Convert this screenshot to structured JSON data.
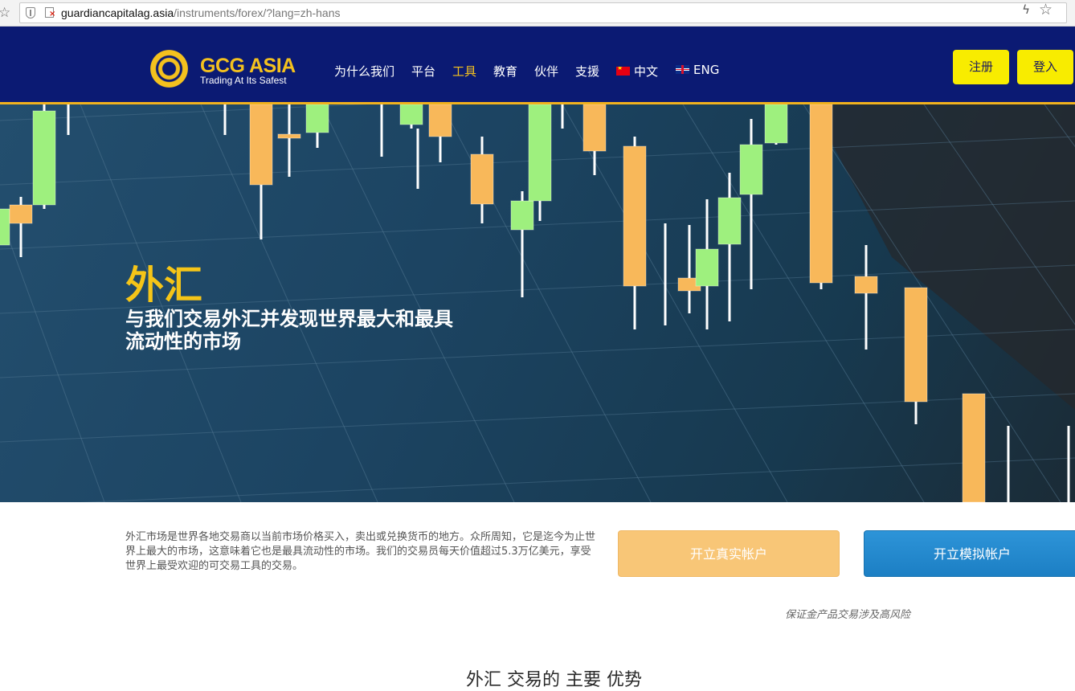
{
  "browser": {
    "url_host": "guardiancapitalag.asia",
    "url_path": "/instruments/forex/?lang=zh-hans"
  },
  "header": {
    "logo_name": "GCG ASIA",
    "logo_tagline": "Trading At Its Safest",
    "nav": [
      {
        "label": "为什么我们"
      },
      {
        "label": "平台"
      },
      {
        "label": "工具"
      },
      {
        "label": "教育"
      },
      {
        "label": "伙伴"
      },
      {
        "label": "支援"
      },
      {
        "label": "中文"
      },
      {
        "label": "ENG"
      }
    ],
    "active_nav": "工具",
    "register_label": "注册",
    "login_label": "登入"
  },
  "hero": {
    "title": "外汇",
    "subtitle": "与我们交易外汇并发现世界最大和最具流动性的市场"
  },
  "content": {
    "description": "外汇市场是世界各地交易商以当前市场价格买入，卖出或兑换货币的地方。众所周知，它是迄今为止世界上最大的市场，这意味着它也是最具流动性的市场。我们的交易员每天价值超过5.3万亿美元，享受世界上最受欢迎的可交易工具的交易。",
    "open_real_label": "开立真实帐户",
    "open_demo_label": "开立模拟帐户",
    "risk_note": "保证金产品交易涉及高风险",
    "next_section_partial": "外汇 交易的 主要 优势"
  },
  "colors": {
    "header_bg": "#0b1a73",
    "accent_yellow": "#f4c11e",
    "button_yellow": "#f8ec00",
    "real_account": "#f8c677",
    "demo_account": "#1c7fc4"
  }
}
